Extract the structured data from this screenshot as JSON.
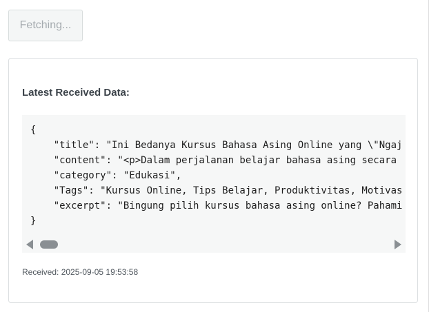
{
  "fetch_button": {
    "label": "Fetching..."
  },
  "card": {
    "heading": "Latest Received Data:",
    "code_text": "{\n    \"title\": \"Ini Bedanya Kursus Bahasa Asing Online yang \\\"Ngaj\n    \"content\": \"<p>Dalam perjalanan belajar bahasa asing secara\n    \"category\": \"Edukasi\",\n    \"Tags\": \"Kursus Online, Tips Belajar, Produktivitas, Motivas\n    \"excerpt\": \"Bingung pilih kursus bahasa asing online? Pahami\n}",
    "received_text": "Received: 2025-09-05 19:53:58"
  },
  "scrollbar": {
    "left_icon": "chevron-left-icon",
    "right_icon": "chevron-right-icon"
  }
}
